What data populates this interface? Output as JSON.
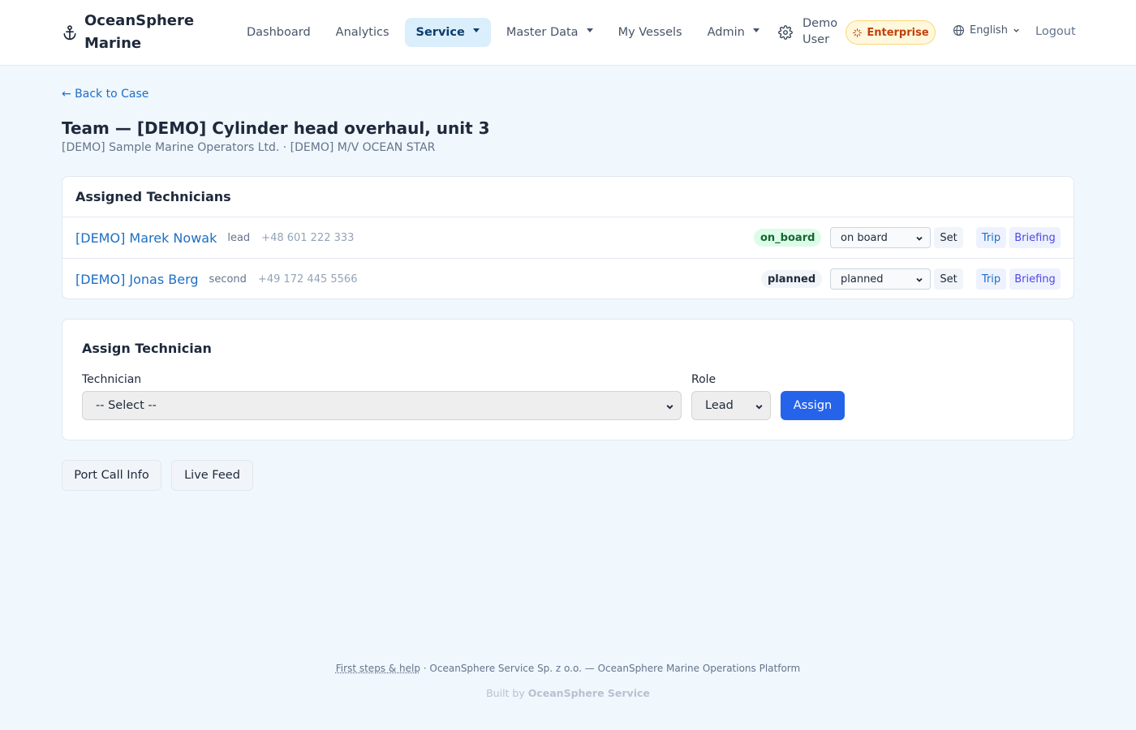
{
  "header": {
    "brand_line1": "OceanSphere",
    "brand_line2": "Marine",
    "nav": [
      {
        "label": "Dashboard"
      },
      {
        "label": "Analytics"
      },
      {
        "label": "Service"
      },
      {
        "label": "Master Data"
      },
      {
        "label": "My Vessels"
      },
      {
        "label": "Admin"
      }
    ],
    "user_line1": "Demo",
    "user_line2": "User",
    "plan_badge": "Enterprise",
    "language": "English",
    "logout": "Logout"
  },
  "page": {
    "back_link": "← Back to Case",
    "title": "Team — [DEMO] Cylinder head overhaul, unit 3",
    "subtitle": "[DEMO] Sample Marine Operators Ltd. · [DEMO] M/V OCEAN STAR"
  },
  "assigned": {
    "title": "Assigned Technicians",
    "technicians": [
      {
        "name": "[DEMO] Marek Nowak",
        "role": "lead",
        "phone": "+48 601 222 333",
        "status": "on_board",
        "status_select": "on board",
        "set_label": "Set",
        "trip_label": "Trip",
        "briefing_label": "Briefing"
      },
      {
        "name": "[DEMO] Jonas Berg",
        "role": "second",
        "phone": "+49 172 445 5566",
        "status": "planned",
        "status_select": "planned",
        "set_label": "Set",
        "trip_label": "Trip",
        "briefing_label": "Briefing"
      }
    ]
  },
  "assign_form": {
    "title": "Assign Technician",
    "technician_label": "Technician",
    "technician_value": "-- Select --",
    "role_label": "Role",
    "role_value": "Lead",
    "assign_button": "Assign"
  },
  "actions": {
    "port_call": "Port Call Info",
    "live_feed": "Live Feed"
  },
  "footer": {
    "help_link": "First steps & help",
    "company_text": " · OceanSphere Service Sp. z o.o. — OceanSphere Marine Operations Platform",
    "built_by": "Built by ",
    "built_brand": "OceanSphere Service"
  },
  "colors": {
    "accent": "#2563eb",
    "link": "#1d6fc5",
    "nav_active_bg": "#dbeefc",
    "status_on_board_bg": "#dcfce7",
    "status_on_board_text": "#166534",
    "enterprise_bg": "#fff8dc",
    "enterprise_text": "#c2410c"
  },
  "icons": {
    "brand": "anchor-icon",
    "settings": "gear-icon",
    "plan": "sparkle-icon",
    "language": "globe-icon"
  }
}
